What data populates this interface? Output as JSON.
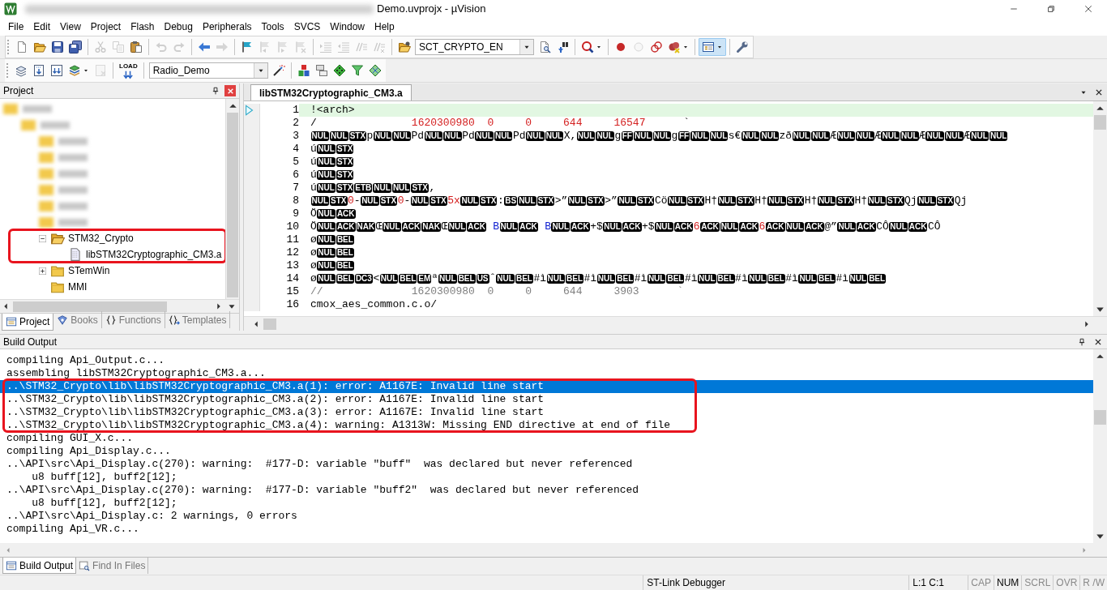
{
  "window": {
    "title": "Demo.uvprojx - µVision"
  },
  "menu": [
    "File",
    "Edit",
    "View",
    "Project",
    "Flash",
    "Debug",
    "Peripherals",
    "Tools",
    "SVCS",
    "Window",
    "Help"
  ],
  "toolbar_1": {
    "items": [
      {
        "kind": "button",
        "disabled": false
      },
      {
        "kind": "button",
        "disabled": false
      },
      {
        "kind": "button",
        "disabled": false
      },
      {
        "kind": "button",
        "disabled": false
      },
      {
        "kind": "separator"
      },
      {
        "kind": "button",
        "disabled": true
      },
      {
        "kind": "button",
        "disabled": true
      },
      {
        "kind": "button",
        "disabled": false
      },
      {
        "kind": "separator"
      },
      {
        "kind": "button",
        "disabled": true
      },
      {
        "kind": "button",
        "disabled": true
      },
      {
        "kind": "separator"
      },
      {
        "kind": "button",
        "disabled": false
      },
      {
        "kind": "button",
        "disabled": true
      },
      {
        "kind": "separator"
      },
      {
        "kind": "button",
        "disabled": false
      },
      {
        "kind": "button",
        "disabled": true
      },
      {
        "kind": "button",
        "disabled": true
      },
      {
        "kind": "button",
        "disabled": true
      },
      {
        "kind": "separator"
      },
      {
        "kind": "button",
        "disabled": true
      },
      {
        "kind": "button",
        "disabled": true
      },
      {
        "kind": "button",
        "disabled": true
      },
      {
        "kind": "button",
        "disabled": true
      },
      {
        "kind": "separator"
      },
      {
        "kind": "button",
        "disabled": false
      },
      {
        "kind": "combo",
        "value": "SCT_CRYPTO_EN"
      },
      {
        "kind": "button",
        "disabled": false
      },
      {
        "kind": "button",
        "disabled": false
      },
      {
        "kind": "separator"
      },
      {
        "kind": "split",
        "disabled": false
      },
      {
        "kind": "separator"
      },
      {
        "kind": "button",
        "disabled": false
      },
      {
        "kind": "button",
        "disabled": true
      },
      {
        "kind": "button",
        "disabled": false
      },
      {
        "kind": "split",
        "disabled": false
      },
      {
        "kind": "separator"
      },
      {
        "kind": "toggle",
        "on": true
      },
      {
        "kind": "separator"
      },
      {
        "kind": "button",
        "disabled": false
      }
    ]
  },
  "toolbar_2": {
    "items": [
      {
        "kind": "button",
        "disabled": false
      },
      {
        "kind": "button",
        "disabled": false
      },
      {
        "kind": "button",
        "disabled": false
      },
      {
        "kind": "split",
        "disabled": false
      },
      {
        "kind": "button",
        "disabled": true
      },
      {
        "kind": "separator"
      },
      {
        "kind": "button",
        "disabled": false,
        "label": "LOAD"
      },
      {
        "kind": "separator"
      },
      {
        "kind": "combo",
        "value": "Radio_Demo"
      },
      {
        "kind": "button",
        "disabled": false
      },
      {
        "kind": "separator"
      },
      {
        "kind": "button",
        "disabled": false
      },
      {
        "kind": "button",
        "disabled": false
      },
      {
        "kind": "button",
        "disabled": false
      },
      {
        "kind": "button",
        "disabled": false
      },
      {
        "kind": "button",
        "disabled": false
      }
    ]
  },
  "project": {
    "title": "Project",
    "tree": [
      {
        "kind": "blurred",
        "children": [
          {
            "kind": "blurred",
            "children": [
              {
                "kind": "blurred"
              },
              {
                "kind": "blurred"
              },
              {
                "kind": "blurred"
              },
              {
                "kind": "blurred"
              },
              {
                "kind": "blurred"
              },
              {
                "kind": "blurred"
              },
              {
                "kind": "folder",
                "label": "STM32_Crypto",
                "expanded": true,
                "boxed": true,
                "children": [
                  {
                    "kind": "file",
                    "label": "libSTM32Cryptographic_CM3.a",
                    "boxed": true
                  }
                ]
              },
              {
                "kind": "folder",
                "label": "STemWin",
                "expanded": false,
                "boxed": false
              },
              {
                "kind": "folder",
                "label": "MMI",
                "boxed": false
              }
            ]
          }
        ]
      }
    ],
    "tabs": [
      {
        "label": "Project",
        "selected": true
      },
      {
        "label": "Books",
        "selected": false
      },
      {
        "label": "Functions",
        "selected": false
      },
      {
        "label": "Templates",
        "selected": false
      }
    ]
  },
  "editor": {
    "tabs": [
      {
        "label": "libSTM32Cryptographic_CM3.a",
        "selected": true
      }
    ],
    "lines": [
      {
        "number": "1",
        "current": true,
        "segments": [
          {
            "kind": "plain",
            "text": "!<arch>"
          }
        ]
      },
      {
        "number": "2",
        "current": false,
        "segments": [
          {
            "kind": "plain",
            "text": "/               "
          },
          {
            "kind": "number",
            "text": "1620300980  0     0     644     16547"
          },
          {
            "kind": "plain",
            "text": "      `"
          }
        ]
      },
      {
        "number": "3",
        "current": false,
        "segments": [
          {
            "kind": "control",
            "text": "NUL"
          },
          {
            "kind": "control",
            "text": "NUL"
          },
          {
            "kind": "control",
            "text": "STX"
          },
          {
            "kind": "plain",
            "text": "p"
          },
          {
            "kind": "control",
            "text": "NUL"
          },
          {
            "kind": "control",
            "text": "NUL"
          },
          {
            "kind": "plain",
            "text": "Pd"
          },
          {
            "kind": "control",
            "text": "NUL"
          },
          {
            "kind": "control",
            "text": "NUL"
          },
          {
            "kind": "plain",
            "text": "Pd"
          },
          {
            "kind": "control",
            "text": "NUL"
          },
          {
            "kind": "control",
            "text": "NUL"
          },
          {
            "kind": "plain",
            "text": "Pd"
          },
          {
            "kind": "control",
            "text": "NUL"
          },
          {
            "kind": "control",
            "text": "NUL"
          },
          {
            "kind": "plain",
            "text": "X,"
          },
          {
            "kind": "control",
            "text": "NUL"
          },
          {
            "kind": "control",
            "text": "NUL"
          },
          {
            "kind": "plain",
            "text": "g"
          },
          {
            "kind": "control",
            "text": "FF"
          },
          {
            "kind": "control",
            "text": "NUL"
          },
          {
            "kind": "control",
            "text": "NUL"
          },
          {
            "kind": "plain",
            "text": "g"
          },
          {
            "kind": "control",
            "text": "FF"
          },
          {
            "kind": "control",
            "text": "NUL"
          },
          {
            "kind": "control",
            "text": "NUL"
          },
          {
            "kind": "plain",
            "text": "s€"
          },
          {
            "kind": "control",
            "text": "NUL"
          },
          {
            "kind": "control",
            "text": "NUL"
          },
          {
            "kind": "plain",
            "text": "zð"
          },
          {
            "kind": "control",
            "text": "NUL"
          },
          {
            "kind": "control",
            "text": "NUL"
          },
          {
            "kind": "plain",
            "text": "Æ"
          },
          {
            "kind": "control",
            "text": "NUL"
          },
          {
            "kind": "control",
            "text": "NUL"
          },
          {
            "kind": "plain",
            "text": "Æ"
          },
          {
            "kind": "control",
            "text": "NUL"
          },
          {
            "kind": "control",
            "text": "NUL"
          },
          {
            "kind": "plain",
            "text": "Æ"
          },
          {
            "kind": "control",
            "text": "NUL"
          },
          {
            "kind": "control",
            "text": "NUL"
          },
          {
            "kind": "plain",
            "text": "Æ"
          },
          {
            "kind": "control",
            "text": "NUL"
          },
          {
            "kind": "control",
            "text": "NUL"
          }
        ]
      },
      {
        "number": "4",
        "current": false,
        "segments": [
          {
            "kind": "plain",
            "text": "ú"
          },
          {
            "kind": "control",
            "text": "NUL"
          },
          {
            "kind": "control",
            "text": "STX"
          }
        ]
      },
      {
        "number": "5",
        "current": false,
        "segments": [
          {
            "kind": "plain",
            "text": "ú"
          },
          {
            "kind": "control",
            "text": "NUL"
          },
          {
            "kind": "control",
            "text": "STX"
          }
        ]
      },
      {
        "number": "6",
        "current": false,
        "segments": [
          {
            "kind": "plain",
            "text": "ú"
          },
          {
            "kind": "control",
            "text": "NUL"
          },
          {
            "kind": "control",
            "text": "STX"
          }
        ]
      },
      {
        "number": "7",
        "current": false,
        "segments": [
          {
            "kind": "plain",
            "text": "ú"
          },
          {
            "kind": "control",
            "text": "NUL"
          },
          {
            "kind": "control",
            "text": "STX"
          },
          {
            "kind": "control",
            "text": "ETB"
          },
          {
            "kind": "control",
            "text": "NUL"
          },
          {
            "kind": "control",
            "text": "NUL"
          },
          {
            "kind": "control",
            "text": "STX"
          },
          {
            "kind": "plain",
            "text": ","
          }
        ]
      },
      {
        "number": "8",
        "current": false,
        "segments": [
          {
            "kind": "control",
            "text": "NUL"
          },
          {
            "kind": "control",
            "text": "STX"
          },
          {
            "kind": "number",
            "text": "0"
          },
          {
            "kind": "plain",
            "text": "-"
          },
          {
            "kind": "control",
            "text": "NUL"
          },
          {
            "kind": "control",
            "text": "STX"
          },
          {
            "kind": "number",
            "text": "0"
          },
          {
            "kind": "plain",
            "text": "-"
          },
          {
            "kind": "control",
            "text": "NUL"
          },
          {
            "kind": "control",
            "text": "STX"
          },
          {
            "kind": "number",
            "text": "5x"
          },
          {
            "kind": "control",
            "text": "NUL"
          },
          {
            "kind": "control",
            "text": "STX"
          },
          {
            "kind": "plain",
            "text": ":"
          },
          {
            "kind": "control",
            "text": "BS"
          },
          {
            "kind": "control",
            "text": "NUL"
          },
          {
            "kind": "control",
            "text": "STX"
          },
          {
            "kind": "plain",
            "text": ">”"
          },
          {
            "kind": "control",
            "text": "NUL"
          },
          {
            "kind": "control",
            "text": "STX"
          },
          {
            "kind": "plain",
            "text": ">”"
          },
          {
            "kind": "control",
            "text": "NUL"
          },
          {
            "kind": "control",
            "text": "STX"
          },
          {
            "kind": "plain",
            "text": "Cö"
          },
          {
            "kind": "control",
            "text": "NUL"
          },
          {
            "kind": "control",
            "text": "STX"
          },
          {
            "kind": "plain",
            "text": "H†"
          },
          {
            "kind": "control",
            "text": "NUL"
          },
          {
            "kind": "control",
            "text": "STX"
          },
          {
            "kind": "plain",
            "text": "H†"
          },
          {
            "kind": "control",
            "text": "NUL"
          },
          {
            "kind": "control",
            "text": "STX"
          },
          {
            "kind": "plain",
            "text": "H†"
          },
          {
            "kind": "control",
            "text": "NUL"
          },
          {
            "kind": "control",
            "text": "STX"
          },
          {
            "kind": "plain",
            "text": "H†"
          },
          {
            "kind": "control",
            "text": "NUL"
          },
          {
            "kind": "control",
            "text": "STX"
          },
          {
            "kind": "plain",
            "text": "Qj"
          },
          {
            "kind": "control",
            "text": "NUL"
          },
          {
            "kind": "control",
            "text": "STX"
          },
          {
            "kind": "plain",
            "text": "Qj"
          }
        ]
      },
      {
        "number": "9",
        "current": false,
        "segments": [
          {
            "kind": "plain",
            "text": "Ö"
          },
          {
            "kind": "control",
            "text": "NUL"
          },
          {
            "kind": "control",
            "text": "ACK"
          }
        ]
      },
      {
        "number": "10",
        "current": false,
        "segments": [
          {
            "kind": "plain",
            "text": "Ö"
          },
          {
            "kind": "control",
            "text": "NUL"
          },
          {
            "kind": "control",
            "text": "ACK"
          },
          {
            "kind": "control",
            "text": "NAK"
          },
          {
            "kind": "plain",
            "text": "Œ"
          },
          {
            "kind": "control",
            "text": "NUL"
          },
          {
            "kind": "control",
            "text": "ACK"
          },
          {
            "kind": "control",
            "text": "NAK"
          },
          {
            "kind": "plain",
            "text": "Œ"
          },
          {
            "kind": "control",
            "text": "NUL"
          },
          {
            "kind": "control",
            "text": "ACK"
          },
          {
            "kind": "keyword",
            "text": " B"
          },
          {
            "kind": "control",
            "text": "NUL"
          },
          {
            "kind": "control",
            "text": "ACK"
          },
          {
            "kind": "keyword",
            "text": " B"
          },
          {
            "kind": "control",
            "text": "NUL"
          },
          {
            "kind": "control",
            "text": "ACK"
          },
          {
            "kind": "plain",
            "text": "+$"
          },
          {
            "kind": "control",
            "text": "NUL"
          },
          {
            "kind": "control",
            "text": "ACK"
          },
          {
            "kind": "plain",
            "text": "+$"
          },
          {
            "kind": "control",
            "text": "NUL"
          },
          {
            "kind": "control",
            "text": "ACK"
          },
          {
            "kind": "number",
            "text": "6"
          },
          {
            "kind": "control",
            "text": "ACK"
          },
          {
            "kind": "control",
            "text": "NUL"
          },
          {
            "kind": "control",
            "text": "ACK"
          },
          {
            "kind": "number",
            "text": "6"
          },
          {
            "kind": "control",
            "text": "ACK"
          },
          {
            "kind": "control",
            "text": "NUL"
          },
          {
            "kind": "control",
            "text": "ACK"
          },
          {
            "kind": "plain",
            "text": "@”"
          },
          {
            "kind": "control",
            "text": "NUL"
          },
          {
            "kind": "control",
            "text": "ACK"
          },
          {
            "kind": "plain",
            "text": "CÔ"
          },
          {
            "kind": "control",
            "text": "NUL"
          },
          {
            "kind": "control",
            "text": "ACK"
          },
          {
            "kind": "plain",
            "text": "CÔ"
          }
        ]
      },
      {
        "number": "11",
        "current": false,
        "segments": [
          {
            "kind": "plain",
            "text": "ø"
          },
          {
            "kind": "control",
            "text": "NUL"
          },
          {
            "kind": "control",
            "text": "BEL"
          }
        ]
      },
      {
        "number": "12",
        "current": false,
        "segments": [
          {
            "kind": "plain",
            "text": "ø"
          },
          {
            "kind": "control",
            "text": "NUL"
          },
          {
            "kind": "control",
            "text": "BEL"
          }
        ]
      },
      {
        "number": "13",
        "current": false,
        "segments": [
          {
            "kind": "plain",
            "text": "ø"
          },
          {
            "kind": "control",
            "text": "NUL"
          },
          {
            "kind": "control",
            "text": "BEL"
          }
        ]
      },
      {
        "number": "14",
        "current": false,
        "segments": [
          {
            "kind": "plain",
            "text": "ø"
          },
          {
            "kind": "control",
            "text": "NUL"
          },
          {
            "kind": "control",
            "text": "BEL"
          },
          {
            "kind": "control",
            "text": "DC3"
          },
          {
            "kind": "plain",
            "text": "<"
          },
          {
            "kind": "control",
            "text": "NUL"
          },
          {
            "kind": "control",
            "text": "BEL"
          },
          {
            "kind": "control",
            "text": "EM"
          },
          {
            "kind": "plain",
            "text": "ª"
          },
          {
            "kind": "control",
            "text": "NUL"
          },
          {
            "kind": "control",
            "text": "BEL"
          },
          {
            "kind": "control",
            "text": "US"
          },
          {
            "kind": "plain",
            "text": "ˆ"
          },
          {
            "kind": "control",
            "text": "NUL"
          },
          {
            "kind": "control",
            "text": "BEL"
          },
          {
            "kind": "plain",
            "text": "#ì"
          },
          {
            "kind": "control",
            "text": "NUL"
          },
          {
            "kind": "control",
            "text": "BEL"
          },
          {
            "kind": "plain",
            "text": "#ì"
          },
          {
            "kind": "control",
            "text": "NUL"
          },
          {
            "kind": "control",
            "text": "BEL"
          },
          {
            "kind": "plain",
            "text": "#ì"
          },
          {
            "kind": "control",
            "text": "NUL"
          },
          {
            "kind": "control",
            "text": "BEL"
          },
          {
            "kind": "plain",
            "text": "#ì"
          },
          {
            "kind": "control",
            "text": "NUL"
          },
          {
            "kind": "control",
            "text": "BEL"
          },
          {
            "kind": "plain",
            "text": "#ì"
          },
          {
            "kind": "control",
            "text": "NUL"
          },
          {
            "kind": "control",
            "text": "BEL"
          },
          {
            "kind": "plain",
            "text": "#ì"
          },
          {
            "kind": "control",
            "text": "NUL"
          },
          {
            "kind": "control",
            "text": "BEL"
          },
          {
            "kind": "plain",
            "text": "#ì"
          },
          {
            "kind": "control",
            "text": "NUL"
          },
          {
            "kind": "control",
            "text": "BEL"
          }
        ]
      },
      {
        "number": "15",
        "current": false,
        "segments": [
          {
            "kind": "comment",
            "text": "//              1620300980  0     0     644     3903      `"
          }
        ]
      },
      {
        "number": "16",
        "current": false,
        "segments": [
          {
            "kind": "plain",
            "text": "cmox_aes_common.c.o/"
          }
        ]
      }
    ]
  },
  "build_output": {
    "title": "Build Output",
    "lines": [
      {
        "text": "compiling Api_Output.c...",
        "selected": false,
        "boxed": false
      },
      {
        "text": "assembling libSTM32Cryptographic_CM3.a...",
        "selected": false,
        "boxed": false
      },
      {
        "text": "..\\STM32_Crypto\\lib\\libSTM32Cryptographic_CM3.a(1): error: A1167E: Invalid line start",
        "selected": true,
        "boxed": true
      },
      {
        "text": "..\\STM32_Crypto\\lib\\libSTM32Cryptographic_CM3.a(2): error: A1167E: Invalid line start",
        "selected": false,
        "boxed": true
      },
      {
        "text": "..\\STM32_Crypto\\lib\\libSTM32Cryptographic_CM3.a(3): error: A1167E: Invalid line start",
        "selected": false,
        "boxed": true
      },
      {
        "text": "..\\STM32_Crypto\\lib\\libSTM32Cryptographic_CM3.a(4): warning: A1313W: Missing END directive at end of file",
        "selected": false,
        "boxed": true
      },
      {
        "text": "compiling GUI_X.c...",
        "selected": false,
        "boxed": false
      },
      {
        "text": "compiling Api_Display.c...",
        "selected": false,
        "boxed": false
      },
      {
        "text": "..\\API\\src\\Api_Display.c(270): warning:  #177-D: variable \"buff\"  was declared but never referenced",
        "selected": false,
        "boxed": false
      },
      {
        "text": "    u8 buff[12], buff2[12];",
        "selected": false,
        "boxed": false
      },
      {
        "text": "..\\API\\src\\Api_Display.c(270): warning:  #177-D: variable \"buff2\"  was declared but never referenced",
        "selected": false,
        "boxed": false
      },
      {
        "text": "    u8 buff[12], buff2[12];",
        "selected": false,
        "boxed": false
      },
      {
        "text": "..\\API\\src\\Api_Display.c: 2 warnings, 0 errors",
        "selected": false,
        "boxed": false
      },
      {
        "text": "compiling Api_VR.c...",
        "selected": false,
        "boxed": false
      }
    ]
  },
  "bottom_tabs": [
    {
      "label": "Build Output",
      "selected": true
    },
    {
      "label": "Find In Files",
      "selected": false
    }
  ],
  "status_bar": {
    "debugger": "ST-Link Debugger",
    "position": "L:1 C:1",
    "indicators": [
      {
        "label": "CAP",
        "on": false
      },
      {
        "label": "NUM",
        "on": true
      },
      {
        "label": "SCRL",
        "on": false
      },
      {
        "label": "OVR",
        "on": false
      },
      {
        "label": "R /W",
        "on": false
      }
    ]
  }
}
